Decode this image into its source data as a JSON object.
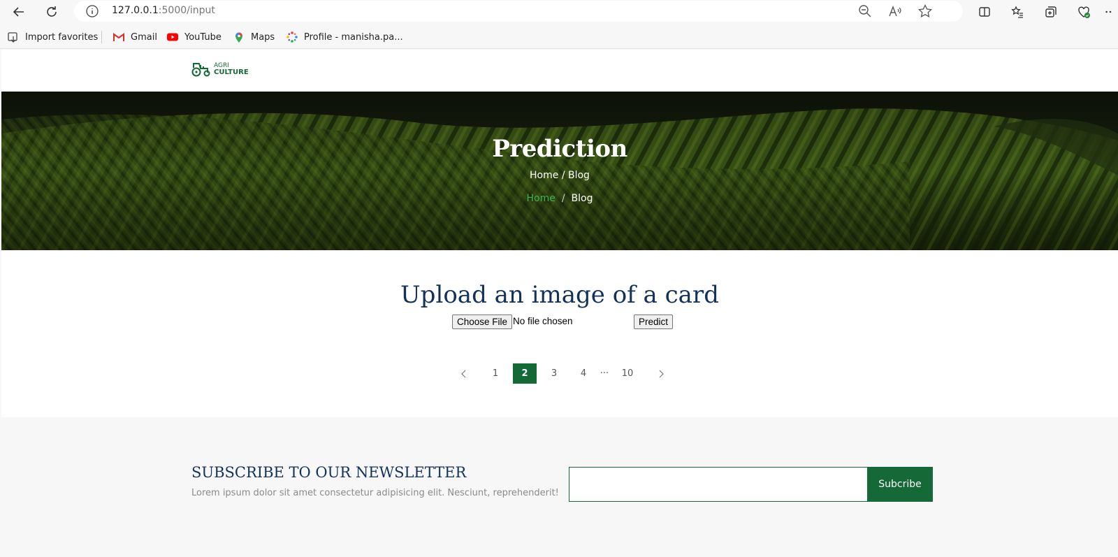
{
  "browser": {
    "url_host": "127.0.0.1",
    "url_path": ":5000/input",
    "bookmarks": [
      "Import favorites",
      "Gmail",
      "YouTube",
      "Maps",
      "Profile - manisha.pa..."
    ]
  },
  "site": {
    "logo_line1": "AGRI",
    "logo_line2": "CULTURE",
    "brand_color": "#156936"
  },
  "hero": {
    "title": "Prediction",
    "breadcrumb_text": "Home / Blog",
    "breadcrumb_home": "Home",
    "breadcrumb_sep": "/",
    "breadcrumb_current": "Blog"
  },
  "upload": {
    "title": "Upload an image of a card",
    "choose_file_label": "Choose File",
    "no_file_text": "No file chosen",
    "predict_label": "Predict"
  },
  "pagination": {
    "pages": [
      "1",
      "2",
      "3",
      "4",
      "...",
      "10"
    ],
    "active": "2"
  },
  "newsletter": {
    "title": "SUBSCRIBE TO OUR NEWSLETTER",
    "subtitle": "Lorem ipsum dolor sit amet consectetur adipisicing elit. Nesciunt, reprehenderit!",
    "input_value": "",
    "button_label": "Subcribe"
  }
}
